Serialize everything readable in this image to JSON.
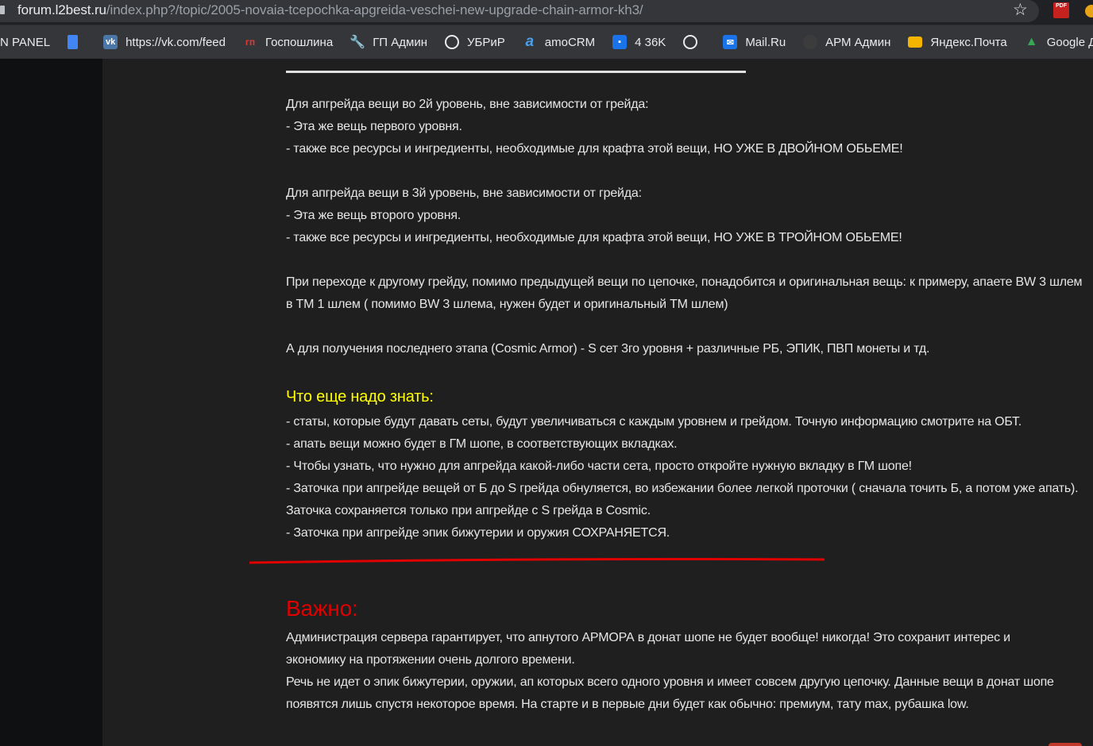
{
  "browser": {
    "url_host": "forum.l2best.ru",
    "url_path": "/index.php?/topic/2005-novaia-tcepochka-apgreida-veschei-new-upgrade-chain-armor-kh3/",
    "pdf_ext_label": "PDF"
  },
  "bookmarks": [
    {
      "label": "N PANEL",
      "icon": "none"
    },
    {
      "label": "",
      "icon": "google-doc-icon"
    },
    {
      "label": "https://vk.com/feed",
      "icon": "vk-icon"
    },
    {
      "label": "Госпошлина",
      "icon": "gp-icon"
    },
    {
      "label": "ГП Админ",
      "icon": "wrench-icon"
    },
    {
      "label": "УБРиР",
      "icon": "globe-icon"
    },
    {
      "label": "amoCRM",
      "icon": "amo-icon"
    },
    {
      "label": "4 36K",
      "icon": "chat-icon"
    },
    {
      "label": "",
      "icon": "globe-icon"
    },
    {
      "label": "Mail.Ru",
      "icon": "mail-icon"
    },
    {
      "label": "АРМ Админ",
      "icon": "arm-icon"
    },
    {
      "label": "Яндекс.Почта",
      "icon": "yandex-mail-icon"
    },
    {
      "label": "Google Диск",
      "icon": "google-drive-icon"
    }
  ],
  "article": {
    "block1": [
      "Для апгрейда вещи во 2й уровень, вне зависимости от грейда:",
      "- Эта же вещь первого уровня.",
      "- также все ресурсы и ингредиенты, необходимые для крафта этой вещи, НО УЖЕ В ДВОЙНОМ ОБЬЕМЕ!"
    ],
    "block2": [
      "Для апгрейда вещи в 3й уровень, вне зависимости от грейда:",
      "- Эта же вещь второго уровня.",
      "- также все ресурсы и ингредиенты, необходимые для крафта этой вещи, НО УЖЕ В ТРОЙНОМ ОБЬЕМЕ!"
    ],
    "block3": "При переходе к другому грейду, помимо предыдущей вещи по цепочке, понадобится и оригинальная вещь: к примеру, апаете BW 3  шлем в ТМ 1 шлем ( помимо BW 3 шлема,  нужен будет и оригинальный ТМ шлем)",
    "block4": "А для получения последнего этапа (Cosmic Armor) - S сет 3го уровня + различные РБ, ЭПИК, ПВП монеты и тд.",
    "heading_know": "Что еще надо знать:",
    "know_items": [
      "- статы, которые будут давать сеты, будут увеличиваться с каждым уровнем и грейдом. Точную информацию смотрите на ОБТ.",
      "- апать вещи можно будет в ГМ шопе, в соответствующих вкладках.",
      "- Чтобы узнать, что нужно для апгрейда какой-либо части сета, просто откройте нужную вкладку в ГМ шопе!",
      "- Заточка при апгрейде вещей от Б до S грейда обнуляется, во избежании более легкой проточки ( сначала точить Б, а потом уже апать). Заточка сохраняется только при апгрейде с S грейда в Cosmic.",
      "- Заточка при апгрейде эпик бижутерии и оружия СОХРАНЯЕТСЯ."
    ],
    "heading_important": "Важно:",
    "important_p1": "Администрация сервера гарантирует, что апнутого АРМОРА в донат шопе не будет вообще! никогда! Это сохранит интерес и экономику на протяжении очень долгого времени.",
    "important_p2": "Речь не идет о эпик бижутерии, оружии, ап которых всего одного уровня и имеет совсем другую цепочку. Данные вещи в донат шопе появятся лишь спустя некоторое время. На старте и в первые дни будет как обычно: премиум, тату max, рубашка low."
  },
  "colors": {
    "heading_yellow": "#ffff00",
    "heading_red": "#e00000",
    "divider_red": "#e00000"
  }
}
